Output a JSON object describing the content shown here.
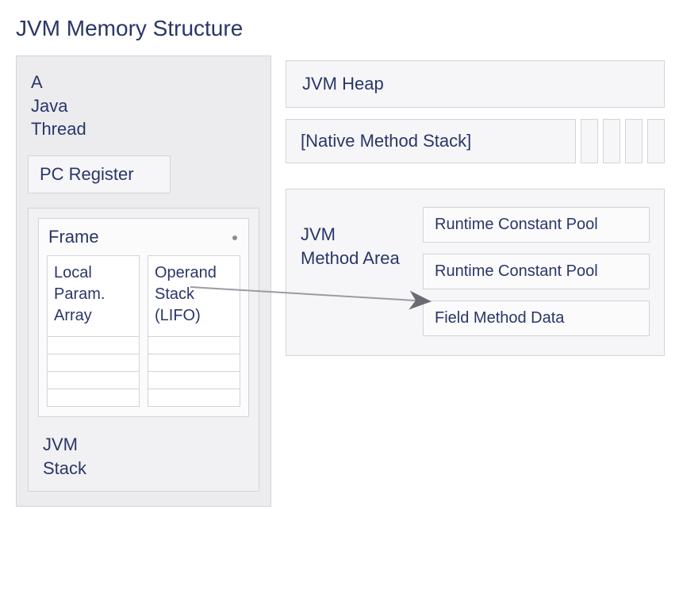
{
  "title": "JVM Memory Structure",
  "thread": {
    "label": "A\nJava\nThread",
    "pc_register": "PC Register",
    "stack": {
      "frame_title": "Frame",
      "local_array": "Local\nParam.\nArray",
      "operand_stack": "Operand\nStack\n(LIFO)",
      "label": "JVM\nStack"
    }
  },
  "heap": "JVM Heap",
  "native_stack": "[Native Method Stack]",
  "method_area": {
    "label": "JVM\nMethod Area",
    "boxes": [
      "Runtime Constant Pool",
      "Runtime Constant Pool",
      "Field Method Data"
    ]
  }
}
